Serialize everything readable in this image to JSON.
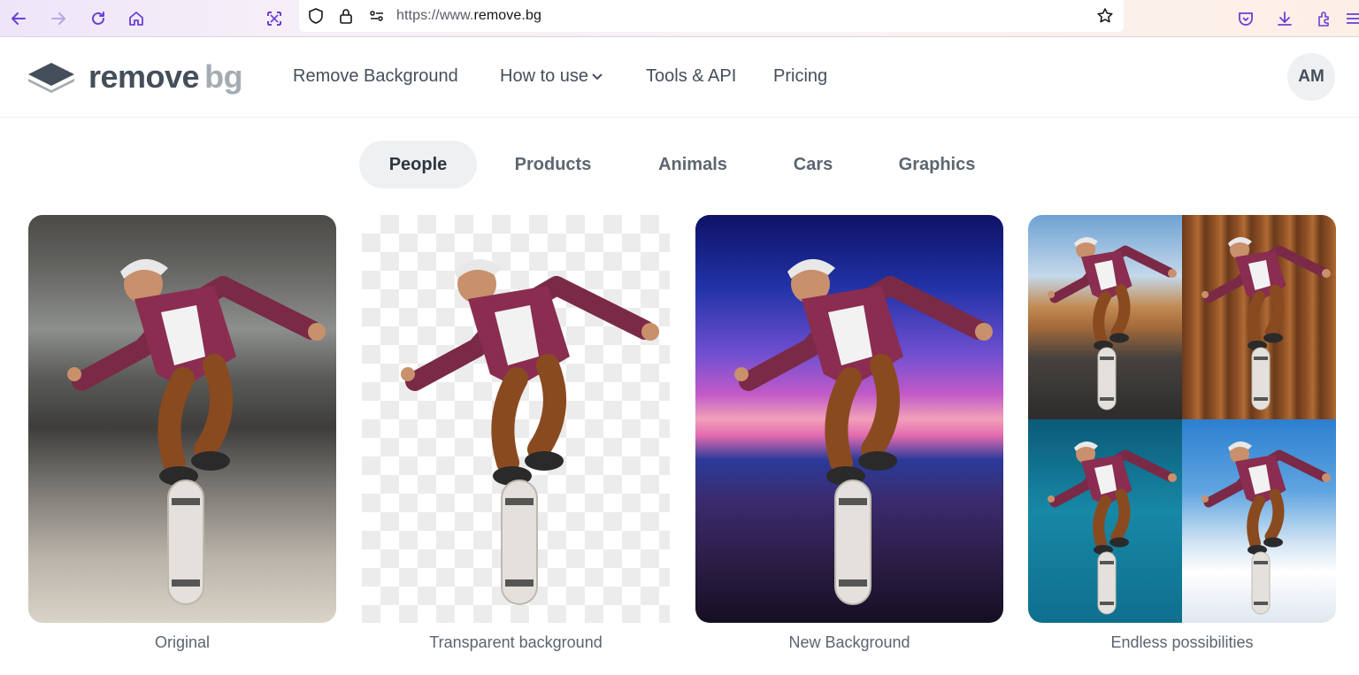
{
  "browser": {
    "url_prefix": "https://www.",
    "url_domain": "remove.bg",
    "icons": [
      "back-icon",
      "forward-icon",
      "reload-icon",
      "home-icon",
      "screenshot-icon",
      "shield-icon",
      "lock-icon",
      "permissions-icon",
      "bookmark-star-icon",
      "pocket-icon",
      "download-icon",
      "extensions-icon",
      "menu-icon"
    ]
  },
  "header": {
    "logo_word": "remove",
    "logo_suffix": "bg",
    "nav": [
      {
        "label": "Remove Background"
      },
      {
        "label": "How to use"
      },
      {
        "label": "Tools & API"
      },
      {
        "label": "Pricing"
      }
    ],
    "avatar_initials": "AM"
  },
  "tabs": [
    {
      "label": "People",
      "active": true
    },
    {
      "label": "Products",
      "active": false
    },
    {
      "label": "Animals",
      "active": false
    },
    {
      "label": "Cars",
      "active": false
    },
    {
      "label": "Graphics",
      "active": false
    }
  ],
  "cards": [
    {
      "caption": "Original"
    },
    {
      "caption": "Transparent background"
    },
    {
      "caption": "New Background"
    },
    {
      "caption": "Endless possibilities"
    }
  ],
  "colors": {
    "text_dark": "#454f5b",
    "tab_active_bg": "#eef0f2",
    "logo_gray": "#a5abb3"
  }
}
